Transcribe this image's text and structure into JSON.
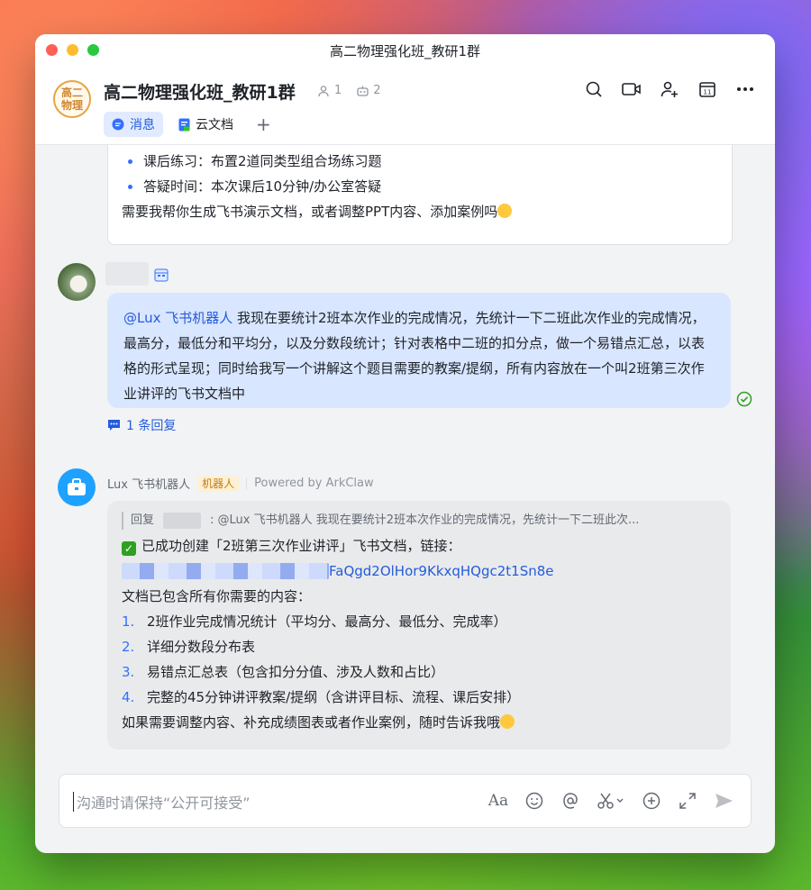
{
  "window": {
    "title": "高二物理强化班_教研1群"
  },
  "header": {
    "avatar_text": "高二物理",
    "group_name": "高二物理强化班_教研1群",
    "member_count": "1",
    "bot_count": "2",
    "icons": [
      "search-icon",
      "video-icon",
      "add-member-icon",
      "calendar-icon",
      "more-icon"
    ],
    "tabs": [
      {
        "label": "消息",
        "icon": "message-icon",
        "active": true
      },
      {
        "label": "云文档",
        "icon": "doc-icon",
        "active": false
      }
    ],
    "add_tab_label": "+"
  },
  "messages": {
    "prev_card": {
      "bullets": [
        "课后练习：布置2道同类型组合场练习题",
        "答疑时间：本次课后10分钟/办公室答疑"
      ],
      "closing": "需要我帮你生成飞书演示文档，或者调整PPT内容、添加案例吗"
    },
    "user_msg": {
      "mention": "@Lux 飞书机器人",
      "text": " 我现在要统计2班本次作业的完成情况，先统计一下二班此次作业的完成情况，最高分，最低分和平均分，以及分数段统计；针对表格中二班的扣分点，做一个易错点汇总，以表格的形式呈现；同时给我写一个讲解这个题目需要的教案/提纲，所有内容放在一个叫2班第三次作业讲评的飞书文档中",
      "reply_count": "1 条回复"
    },
    "bot_msg": {
      "name": "Lux 飞书机器人",
      "badge": "机器人",
      "powered": "Powered by ArkClaw",
      "quote_prefix": "回复",
      "quote_text": ": @Lux 飞书机器人 我现在要统计2班本次作业的完成情况，先统计一下二班此次...",
      "created": "已成功创建「2班第三次作业讲评」飞书文档，链接：",
      "link_tail": "FaQgd2OlHor9KkxqHQgc2t1Sn8e",
      "intro": "文档已包含所有你需要的内容：",
      "items": [
        {
          "n": "1.",
          "t": "2班作业完成情况统计（平均分、最高分、最低分、完成率）"
        },
        {
          "n": "2.",
          "t": "详细分数段分布表"
        },
        {
          "n": "3.",
          "t": "易错点汇总表（包含扣分分值、涉及人数和占比）"
        },
        {
          "n": "4.",
          "t": "完整的45分钟讲评教案/提纲（含讲评目标、流程、课后安排）"
        }
      ],
      "closing": "如果需要调整内容、补充成绩图表或者作业案例，随时告诉我哦"
    }
  },
  "composer": {
    "placeholder": "沟通时请保持“公开可接受”",
    "icons": [
      "font-format-icon",
      "emoji-icon",
      "mention-icon",
      "scissors-icon",
      "plus-circle-icon",
      "expand-icon",
      "send-icon"
    ]
  }
}
